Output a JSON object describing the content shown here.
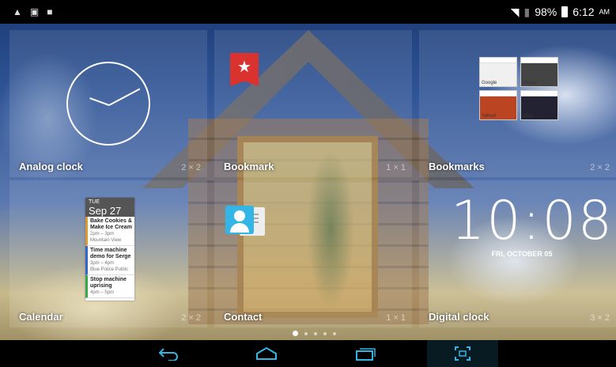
{
  "status_bar": {
    "left_icons": [
      "warning-icon",
      "screen-icon",
      "lock-icon"
    ],
    "battery": "98%",
    "time": "6:12",
    "time_suffix": "AM"
  },
  "widgets": [
    {
      "name": "Analog clock",
      "size": "2 × 2"
    },
    {
      "name": "Bookmark",
      "size": "1 × 1"
    },
    {
      "name": "Bookmarks",
      "size": "2 × 2"
    },
    {
      "name": "Calendar",
      "size": "2 × 2"
    },
    {
      "name": "Contact",
      "size": "1 × 1"
    },
    {
      "name": "Digital clock",
      "size": "3 × 2"
    }
  ],
  "bookmarks_thumbs": [
    "Google",
    "Picasa",
    "Yahoo!",
    "eBay"
  ],
  "calendar": {
    "dow": "TUE",
    "date": "Sep 27",
    "events": [
      {
        "title": "Bake Cookies & Make Ice Cream",
        "time": "2pm – 3pm",
        "place": "Mountain View"
      },
      {
        "title": "Time machine demo for Serge",
        "time": "3pm – 4pm",
        "place": "Blue Police Public"
      },
      {
        "title": "Stop machine uprising",
        "time": "4pm – 5pm",
        "place": ""
      }
    ]
  },
  "digital_clock": {
    "time": "10:08",
    "date": "FRI, OCTOBER 05"
  },
  "pages": {
    "count": 5,
    "active": 1
  },
  "nav": [
    "back-icon",
    "home-icon",
    "recent-apps-icon",
    "screenshot-icon"
  ]
}
